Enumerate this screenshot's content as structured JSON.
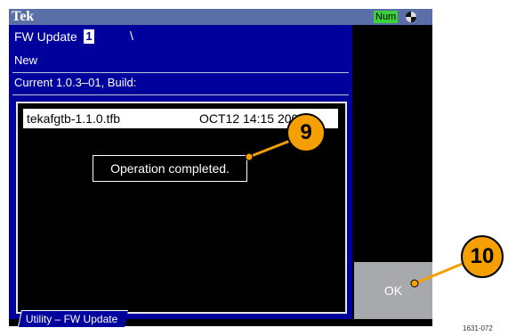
{
  "header": {
    "brand": "Tek",
    "num_badge": "Num"
  },
  "panel": {
    "title": "FW Update",
    "cursor_char": "1",
    "path": "\\",
    "new_label": "New",
    "current_label": "Current  1.0.3–01, Build:"
  },
  "file_list": {
    "items": [
      {
        "name": "tekafgtb-1.1.0.tfb",
        "date": "OCT12 14:15 2005"
      }
    ]
  },
  "message": "Operation completed.",
  "sidebar": {
    "ok_label": "OK"
  },
  "tab": {
    "label": "Utility – FW Update"
  },
  "callouts": {
    "c9": "9",
    "c10": "10"
  },
  "figure_id": "1631-072",
  "colors": {
    "panel_blue": "#00009c",
    "topbar": "#5a6fa8",
    "num_badge": "#3ad13a",
    "callout": "#f5a000",
    "ok_button": "#a7a9ac"
  }
}
